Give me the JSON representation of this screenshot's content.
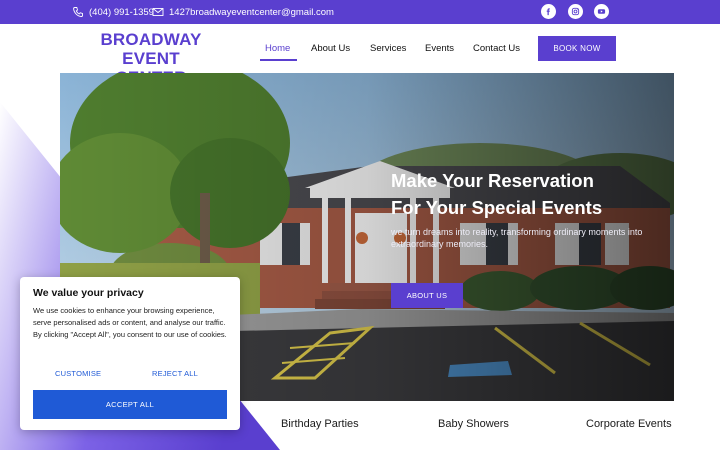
{
  "topbar": {
    "phone": "(404) 991-1359",
    "email": "1427broadwayeventcenter@gmail.com",
    "social": [
      {
        "name": "facebook-icon"
      },
      {
        "name": "instagram-icon"
      },
      {
        "name": "youtube-icon"
      }
    ]
  },
  "header": {
    "logo_line1": "BROADWAY",
    "logo_line2": "EVENT CENTER",
    "nav": [
      "Home",
      "About Us",
      "Services",
      "Events",
      "Contact Us"
    ],
    "book_button": "BOOK NOW"
  },
  "hero": {
    "title_line1": "Make Your Reservation",
    "title_line2": "For Your Special Events",
    "subtitle": "we turn dreams into reality, transforming ordinary moments into extraordinary memories.",
    "button": "ABOUT US"
  },
  "services": [
    "Birthday Parties",
    "Baby Showers",
    "Corporate Events"
  ],
  "cookie": {
    "title": "We value your privacy",
    "body": "We use cookies to enhance your browsing experience, serve personalised ads or content, and analyse our traffic. By clicking \"Accept All\", you consent to our use of cookies.",
    "customise": "CUSTOMISE",
    "reject": "REJECT ALL",
    "accept": "ACCEPT ALL"
  },
  "colors": {
    "brand": "#5a3fcf",
    "cookie_accent": "#1f5ad6"
  }
}
